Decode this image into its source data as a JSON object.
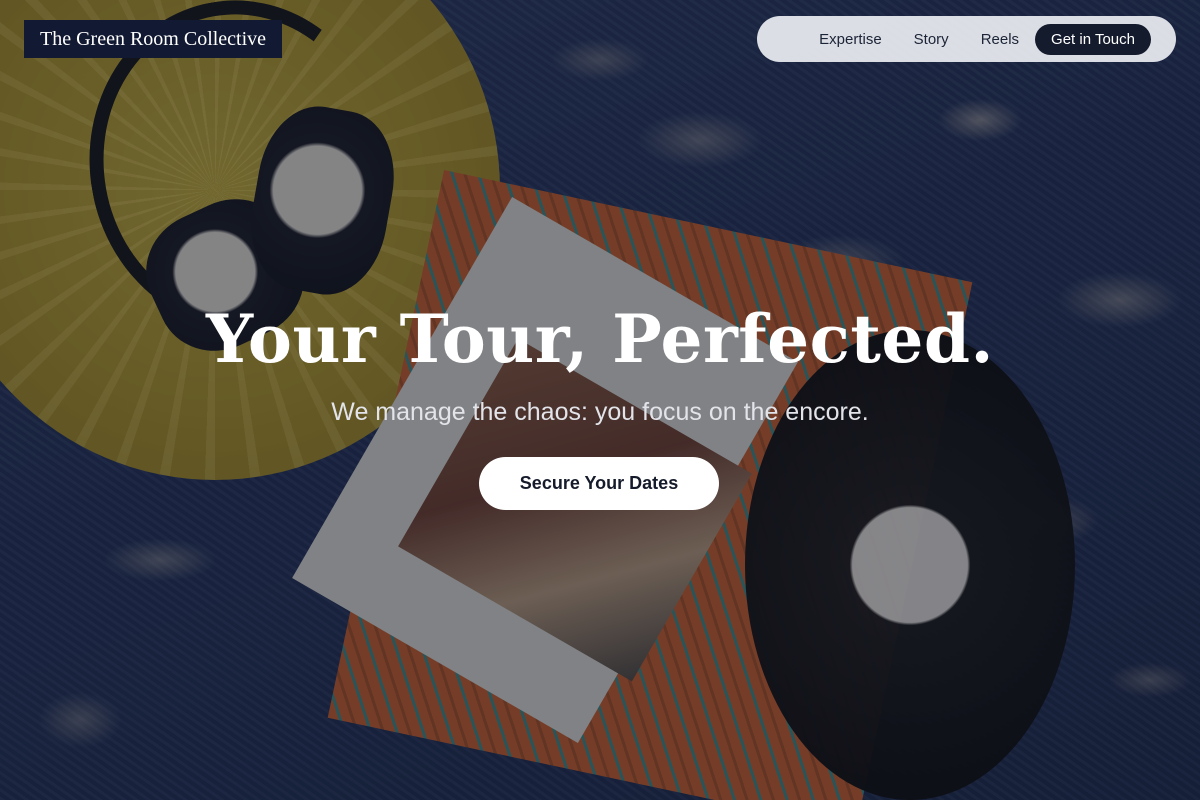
{
  "brand": {
    "name": "The Green Room Collective"
  },
  "nav": {
    "links": [
      {
        "label": "Expertise"
      },
      {
        "label": "Story"
      },
      {
        "label": "Reels"
      }
    ],
    "cta_label": "Get in Touch"
  },
  "hero": {
    "title": "Your Tour, Perfected.",
    "subtitle": "We manage the chaos: you focus on the encore.",
    "cta_label": "Secure Your Dates",
    "background_image": "headphones on yellow cushion, vinyl record and magazine on rug"
  },
  "colors": {
    "brand_bg": "#121a33",
    "nav_bg": "#eceef2",
    "cta_dark": "#141b2d",
    "button_light": "#ffffff"
  }
}
